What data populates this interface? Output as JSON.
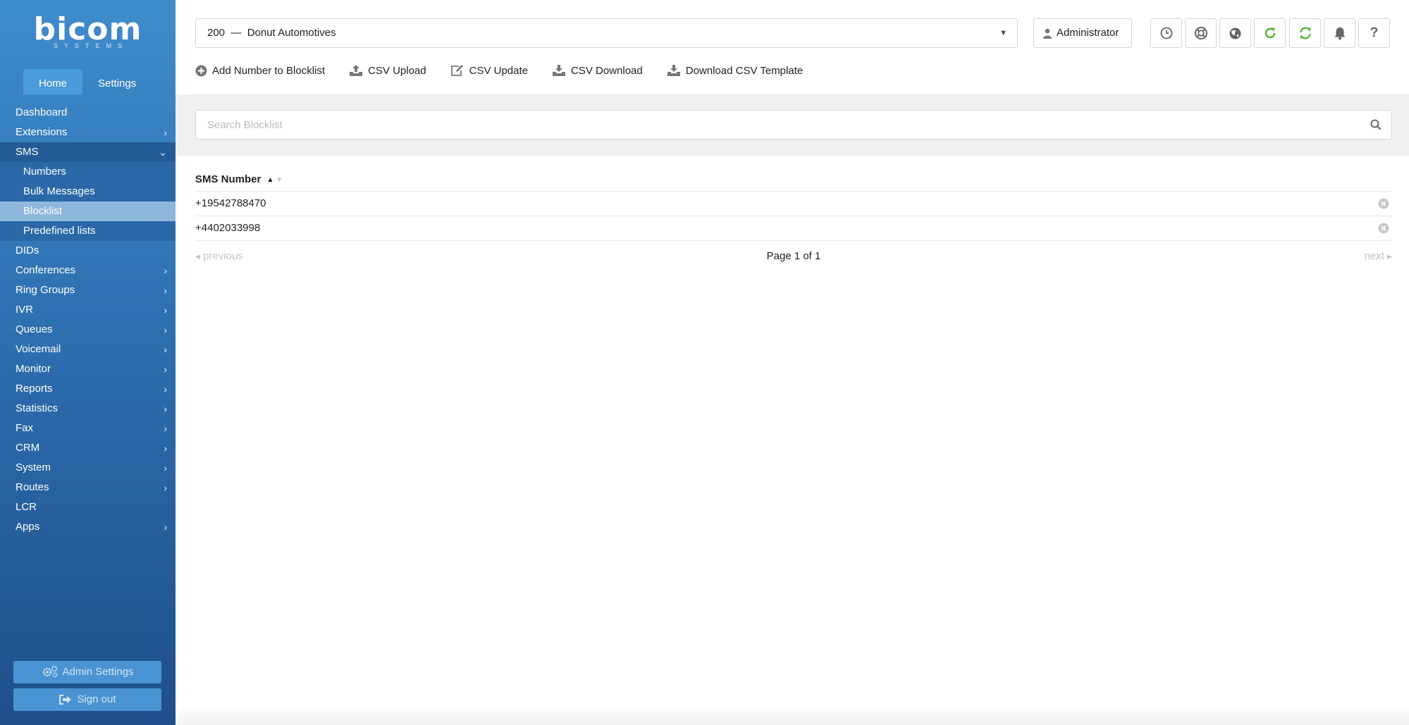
{
  "logo": {
    "name": "bicom",
    "sub": "SYSTEMS"
  },
  "sidebar": {
    "tabs": [
      {
        "label": "Home"
      },
      {
        "label": "Settings"
      }
    ],
    "items": [
      {
        "label": "Dashboard"
      },
      {
        "label": "Extensions"
      },
      {
        "label": "SMS"
      },
      {
        "label": "Numbers"
      },
      {
        "label": "Bulk Messages"
      },
      {
        "label": "Blocklist"
      },
      {
        "label": "Predefined lists"
      },
      {
        "label": "DIDs"
      },
      {
        "label": "Conferences"
      },
      {
        "label": "Ring Groups"
      },
      {
        "label": "IVR"
      },
      {
        "label": "Queues"
      },
      {
        "label": "Voicemail"
      },
      {
        "label": "Monitor"
      },
      {
        "label": "Reports"
      },
      {
        "label": "Statistics"
      },
      {
        "label": "Fax"
      },
      {
        "label": "CRM"
      },
      {
        "label": "System"
      },
      {
        "label": "Routes"
      },
      {
        "label": "LCR"
      },
      {
        "label": "Apps"
      }
    ],
    "admin_settings": "Admin Settings",
    "sign_out": "Sign out"
  },
  "header": {
    "tenant": "200  —  Donut Automotives",
    "user": "Administrator",
    "icons": [
      "clock-icon",
      "support-icon",
      "globe-icon",
      "reload-icon",
      "sync-icon",
      "bell-icon",
      "help-icon"
    ]
  },
  "toolbar": {
    "add": "Add Number to Blocklist",
    "csv_upload": "CSV Upload",
    "csv_update": "CSV Update",
    "csv_download": "CSV Download",
    "csv_template": "Download CSV Template"
  },
  "search": {
    "placeholder": "Search Blocklist"
  },
  "table": {
    "column": "SMS Number",
    "rows": [
      {
        "number": "+19542788470"
      },
      {
        "number": "+4402033998"
      }
    ]
  },
  "pagination": {
    "previous": "previous",
    "info": "Page 1 of 1",
    "next": "next"
  },
  "colors": {
    "sidebar_top": "#3f8ccc",
    "sidebar_bottom": "#1f4f8a",
    "active_tab": "#4a9bdb",
    "selected_item": "#8fb7dd",
    "refresh_green": "#5bb53a"
  }
}
